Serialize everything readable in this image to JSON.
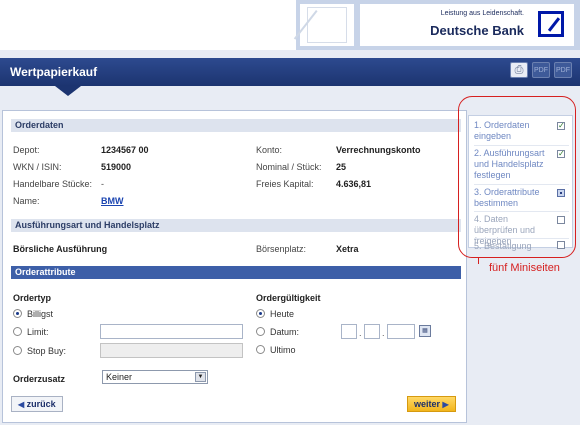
{
  "header": {
    "tagline": "Leistung aus Leidenschaft.",
    "brand": "Deutsche Bank",
    "page_title": "Wertpapierkauf",
    "icons": [
      "printer-icon",
      "pdf-icon",
      "pdf-icon"
    ]
  },
  "orderdaten": {
    "title": "Orderdaten",
    "depot_label": "Depot:",
    "depot_value": "1234567 00",
    "wkn_label": "WKN / ISIN:",
    "wkn_value": "519000",
    "handelbare_label": "Handelbare Stücke:",
    "handelbare_value": "-",
    "name_label": "Name:",
    "name_value": "BMW",
    "konto_label": "Konto:",
    "konto_value": "Verrechnungskonto",
    "nominal_label": "Nominal / Stück:",
    "nominal_value": "25",
    "kapital_label": "Freies Kapital:",
    "kapital_value": "4.636,81"
  },
  "ausfuehrung": {
    "title": "Ausführungsart und Handelsplatz",
    "art_value": "Börsliche Ausführung",
    "boersenplatz_label": "Börsenplatz:",
    "boersenplatz_value": "Xetra"
  },
  "orderattribute": {
    "title": "Orderattribute",
    "ordertyp_title": "Ordertyp",
    "ordertyp_options": [
      "Billigst",
      "Limit:",
      "Stop Buy:"
    ],
    "ordertyp_selected": "Billigst",
    "gueltigkeit_title": "Ordergültigkeit",
    "gueltigkeit_options": [
      "Heute",
      "Datum:",
      "Ultimo"
    ],
    "gueltigkeit_selected": "Heute",
    "orderzusatz_label": "Orderzusatz",
    "orderzusatz_value": "Keiner"
  },
  "buttons": {
    "back": "zurück",
    "next": "weiter"
  },
  "steps": [
    {
      "label": "1. Orderdaten eingeben",
      "state": "done"
    },
    {
      "label": "2. Ausführungsart und Handelsplatz festlegen",
      "state": "done"
    },
    {
      "label": "3. Orderattribute bestimmen",
      "state": "active"
    },
    {
      "label": "4. Daten überprüfen und freigeben",
      "state": "pending"
    },
    {
      "label": "5. Bestätigung",
      "state": "pending"
    }
  ],
  "annotation": "fünf Miniseiten",
  "colors": {
    "title_bar": "#1c3470",
    "accent_blue": "#3d5fa8",
    "next_button": "#f2b51c",
    "annotation_red": "#d62020"
  }
}
